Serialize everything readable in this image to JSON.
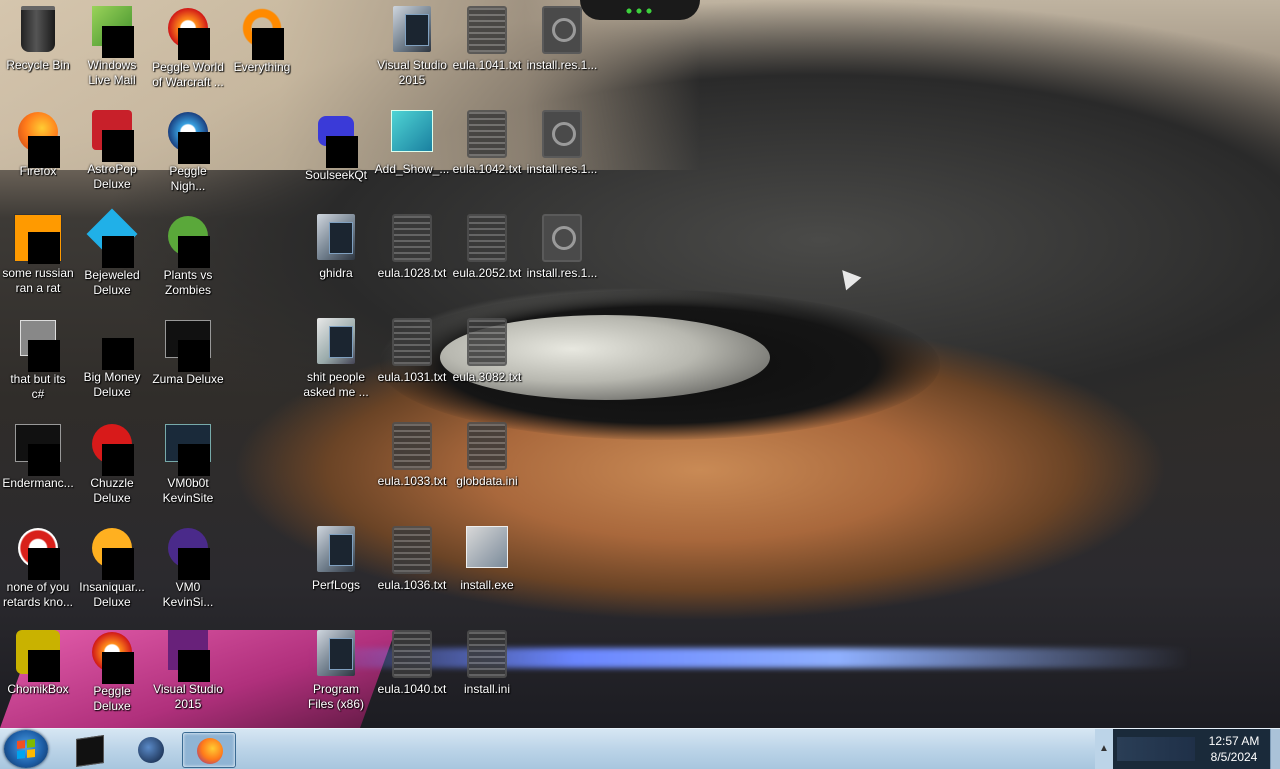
{
  "desktop": {
    "icons": [
      {
        "label": "Recycle Bin",
        "kind": "recycle-bin-icon"
      },
      {
        "label": "Windows\nLive Mail",
        "kind": "mail-icon"
      },
      {
        "label": "Peggle World\nof Warcraft ...",
        "kind": "game-icon"
      },
      {
        "label": "Everything",
        "kind": "search-app-icon"
      },
      {
        "label": "Visual Studio\n2015",
        "kind": "folder-shortcut-icon"
      },
      {
        "label": "eula.1041.txt",
        "kind": "text-file-icon"
      },
      {
        "label": "install.res.1...",
        "kind": "resource-file-icon"
      },
      {
        "label": "Firefox",
        "kind": "firefox-icon"
      },
      {
        "label": "AstroPop\nDeluxe",
        "kind": "game-icon"
      },
      {
        "label": "Peggle\nNigh...",
        "kind": "game-icon"
      },
      {
        "label": "SoulseekQt",
        "kind": "app-icon"
      },
      {
        "label": "Add_Show_...",
        "kind": "registry-file-icon"
      },
      {
        "label": "eula.1042.txt",
        "kind": "text-file-icon"
      },
      {
        "label": "install.res.1...",
        "kind": "resource-file-icon"
      },
      {
        "label": "some russian\nran a rat",
        "kind": "app-icon"
      },
      {
        "label": "Bejeweled\nDeluxe",
        "kind": "game-icon"
      },
      {
        "label": "Plants vs\nZombies",
        "kind": "game-icon"
      },
      {
        "label": "ghidra",
        "kind": "folder-shortcut-icon"
      },
      {
        "label": "eula.1028.txt",
        "kind": "text-file-icon"
      },
      {
        "label": "eula.2052.txt",
        "kind": "text-file-icon"
      },
      {
        "label": "install.res.1...",
        "kind": "resource-file-icon"
      },
      {
        "label": "that but its\nc#",
        "kind": "app-icon"
      },
      {
        "label": "Big Money\nDeluxe",
        "kind": "game-icon"
      },
      {
        "label": "Zuma Deluxe",
        "kind": "game-icon"
      },
      {
        "label": "shit people\nasked me ...",
        "kind": "folder-icon"
      },
      {
        "label": "eula.1031.txt",
        "kind": "text-file-icon"
      },
      {
        "label": "eula.3082.txt",
        "kind": "text-file-icon"
      },
      {
        "label": "Endermanc...",
        "kind": "app-icon"
      },
      {
        "label": "Chuzzle\nDeluxe",
        "kind": "game-icon"
      },
      {
        "label": "VM0b0t\nKevinSite",
        "kind": "app-icon"
      },
      {
        "label": "eula.1033.txt",
        "kind": "text-file-icon"
      },
      {
        "label": "globdata.ini",
        "kind": "settings-file-icon"
      },
      {
        "label": "none of you\nretards kno...",
        "kind": "app-icon"
      },
      {
        "label": "Insaniquar...\nDeluxe",
        "kind": "game-icon"
      },
      {
        "label": "VM0\nKevinSi...",
        "kind": "app-icon"
      },
      {
        "label": "PerfLogs",
        "kind": "folder-shortcut-icon"
      },
      {
        "label": "eula.1036.txt",
        "kind": "text-file-icon"
      },
      {
        "label": "install.exe",
        "kind": "installer-icon"
      },
      {
        "label": "ChomikBox",
        "kind": "app-icon"
      },
      {
        "label": "Peggle\nDeluxe",
        "kind": "game-icon"
      },
      {
        "label": "Visual Studio\n2015",
        "kind": "visual-studio-icon"
      },
      {
        "label": "Program\nFiles (x86)",
        "kind": "folder-shortcut-icon"
      },
      {
        "label": "eula.1040.txt",
        "kind": "text-file-icon"
      },
      {
        "label": "install.ini",
        "kind": "settings-file-icon"
      }
    ]
  },
  "taskbar": {
    "pinned": [
      {
        "name": "command-window-icon"
      },
      {
        "name": "globe-app-icon"
      },
      {
        "name": "firefox-icon",
        "active": true
      }
    ],
    "clock": {
      "time": "12:57 AM",
      "date": "8/5/2024"
    },
    "tray_up_glyph": "▲"
  }
}
